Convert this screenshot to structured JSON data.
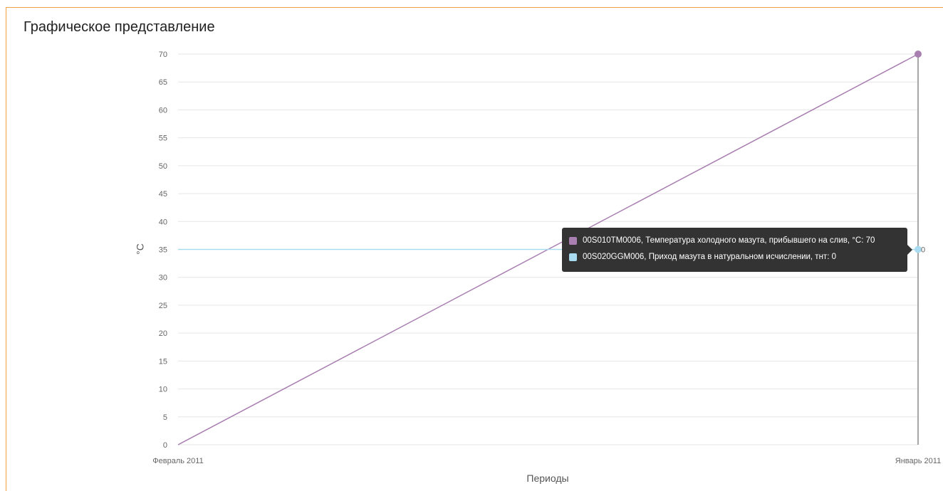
{
  "panel": {
    "title": "Графическое представление"
  },
  "chart_data": {
    "type": "line",
    "xlabel": "Периоды",
    "ylabel": "°C",
    "ylim": [
      0,
      70
    ],
    "yticks": [
      0,
      5,
      10,
      15,
      20,
      25,
      30,
      35,
      40,
      45,
      50,
      55,
      60,
      65,
      70
    ],
    "categories": [
      "Февраль 2011",
      "Январь 2011"
    ],
    "grid": true,
    "series": [
      {
        "name": "00S010TM0006, Температура холодного мазута, прибывшего на слив, °C",
        "color": "#a87fb0",
        "values": [
          0,
          70
        ]
      },
      {
        "name": "00S020GGM006, Приход мазута в натуральном исчислении, тнт",
        "color": "#a8daf0",
        "values": [
          0,
          0
        ]
      }
    ],
    "point_label": "0"
  },
  "tooltip": {
    "rows": [
      {
        "text": "00S010TM0006, Температура холодного мазута, прибывшего на слив, °C: 70",
        "color": "#a87fb0"
      },
      {
        "text": "00S020GGM006, Приход мазута в натуральном исчислении, тнт: 0",
        "color": "#a8daf0"
      }
    ]
  }
}
